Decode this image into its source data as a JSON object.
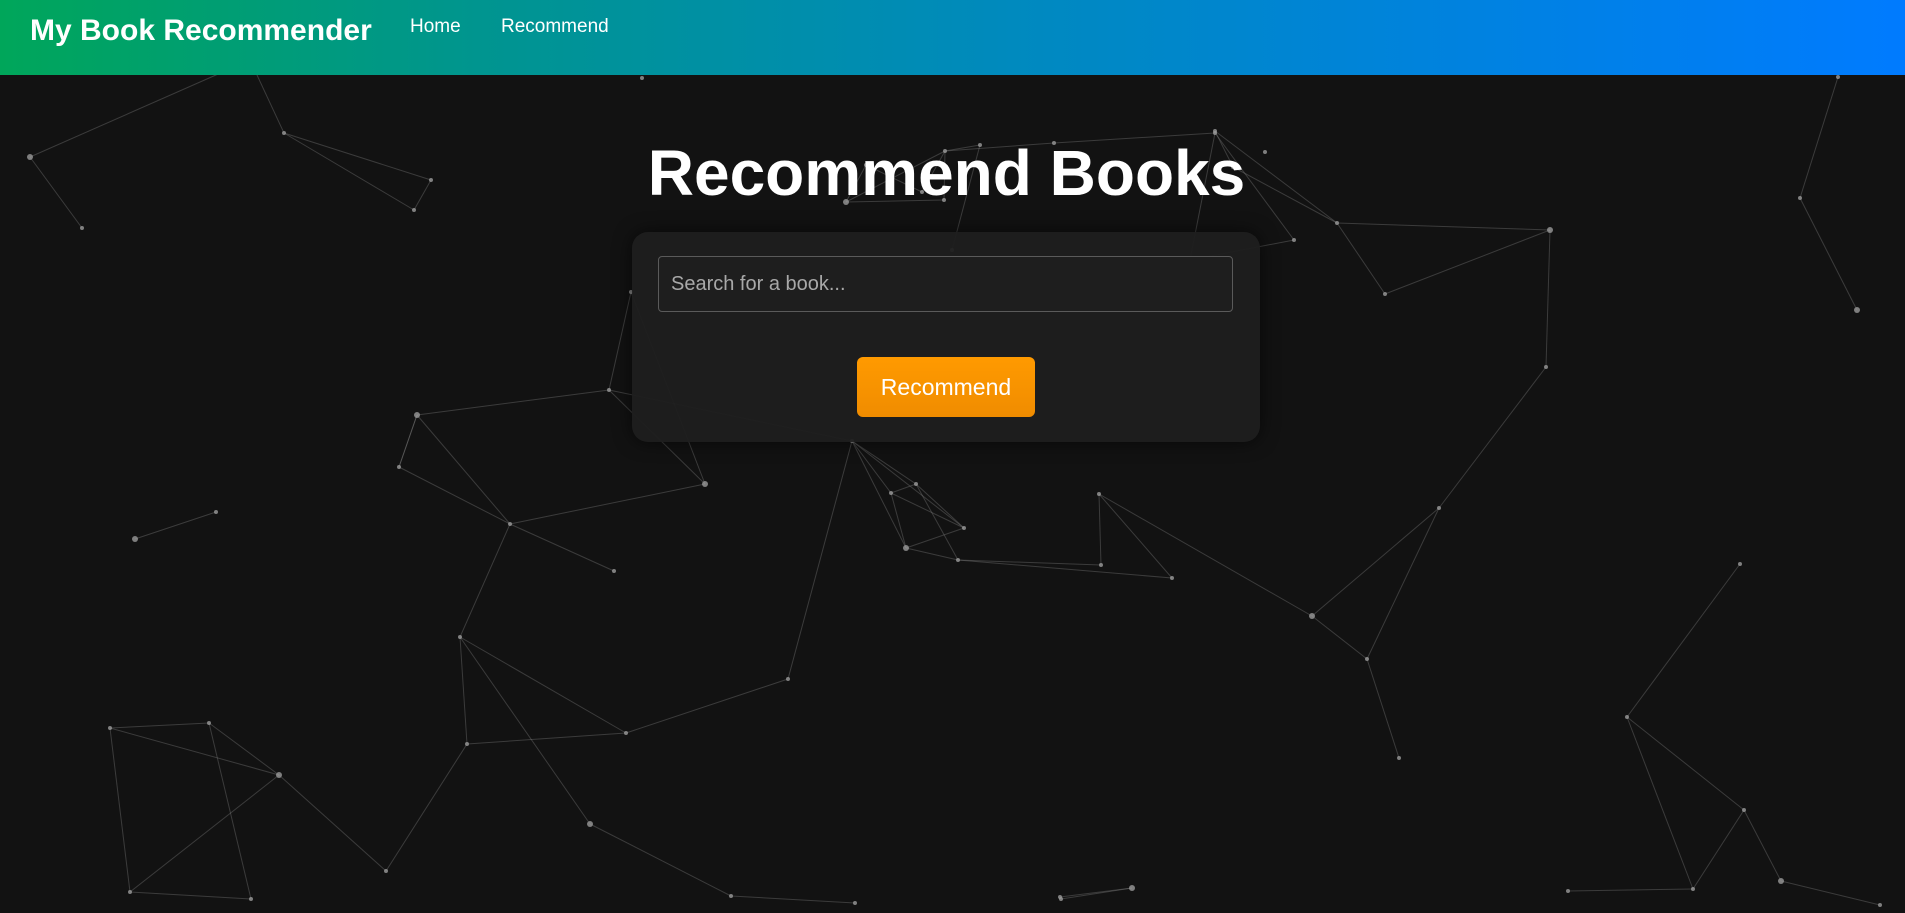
{
  "navbar": {
    "brand": "My Book Recommender",
    "links": [
      {
        "label": "Home"
      },
      {
        "label": "Recommend"
      }
    ]
  },
  "main": {
    "title": "Recommend Books",
    "search": {
      "placeholder": "Search for a book...",
      "value": ""
    },
    "recommend_button": "Recommend"
  },
  "colors": {
    "background": "#121212",
    "card": "#1e1e1e",
    "accent_button": "#ff9500",
    "nav_gradient_start": "#00a65a",
    "nav_gradient_end": "#007bff"
  }
}
